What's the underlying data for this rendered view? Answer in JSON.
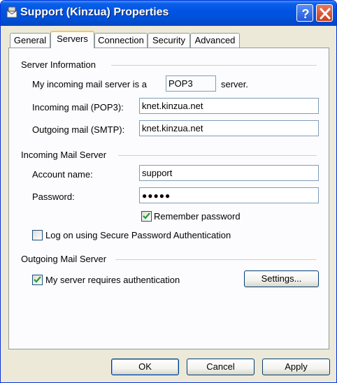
{
  "window": {
    "title": "Support (Kinzua) Properties",
    "title_color": "#ffffff",
    "titlebar_color": "#0054e3"
  },
  "tabs": [
    {
      "label": "General",
      "active": false
    },
    {
      "label": "Servers",
      "active": true
    },
    {
      "label": "Connection",
      "active": false
    },
    {
      "label": "Security",
      "active": false
    },
    {
      "label": "Advanced",
      "active": false
    }
  ],
  "server_info": {
    "heading": "Server Information",
    "incoming_type_prefix": "My incoming mail server is a",
    "incoming_type_value": "POP3",
    "incoming_type_suffix": "server.",
    "incoming_label": "Incoming mail (POP3):",
    "incoming_value": "knet.kinzua.net",
    "outgoing_label": "Outgoing mail (SMTP):",
    "outgoing_value": "knet.kinzua.net"
  },
  "incoming_server": {
    "heading": "Incoming Mail Server",
    "account_label": "Account name:",
    "account_value": "support",
    "password_label": "Password:",
    "password_value": "●●●●●",
    "remember_label": "Remember password",
    "remember_checked": true,
    "spa_label": "Log on using Secure Password Authentication",
    "spa_checked": false
  },
  "outgoing_server": {
    "heading": "Outgoing Mail Server",
    "auth_label": "My server requires authentication",
    "auth_checked": true,
    "settings_label": "Settings..."
  },
  "buttons": {
    "ok": "OK",
    "cancel": "Cancel",
    "apply": "Apply"
  },
  "icons": {
    "app": "mail-properties-icon",
    "help": "help-icon",
    "close": "close-icon",
    "check": "check-icon"
  }
}
